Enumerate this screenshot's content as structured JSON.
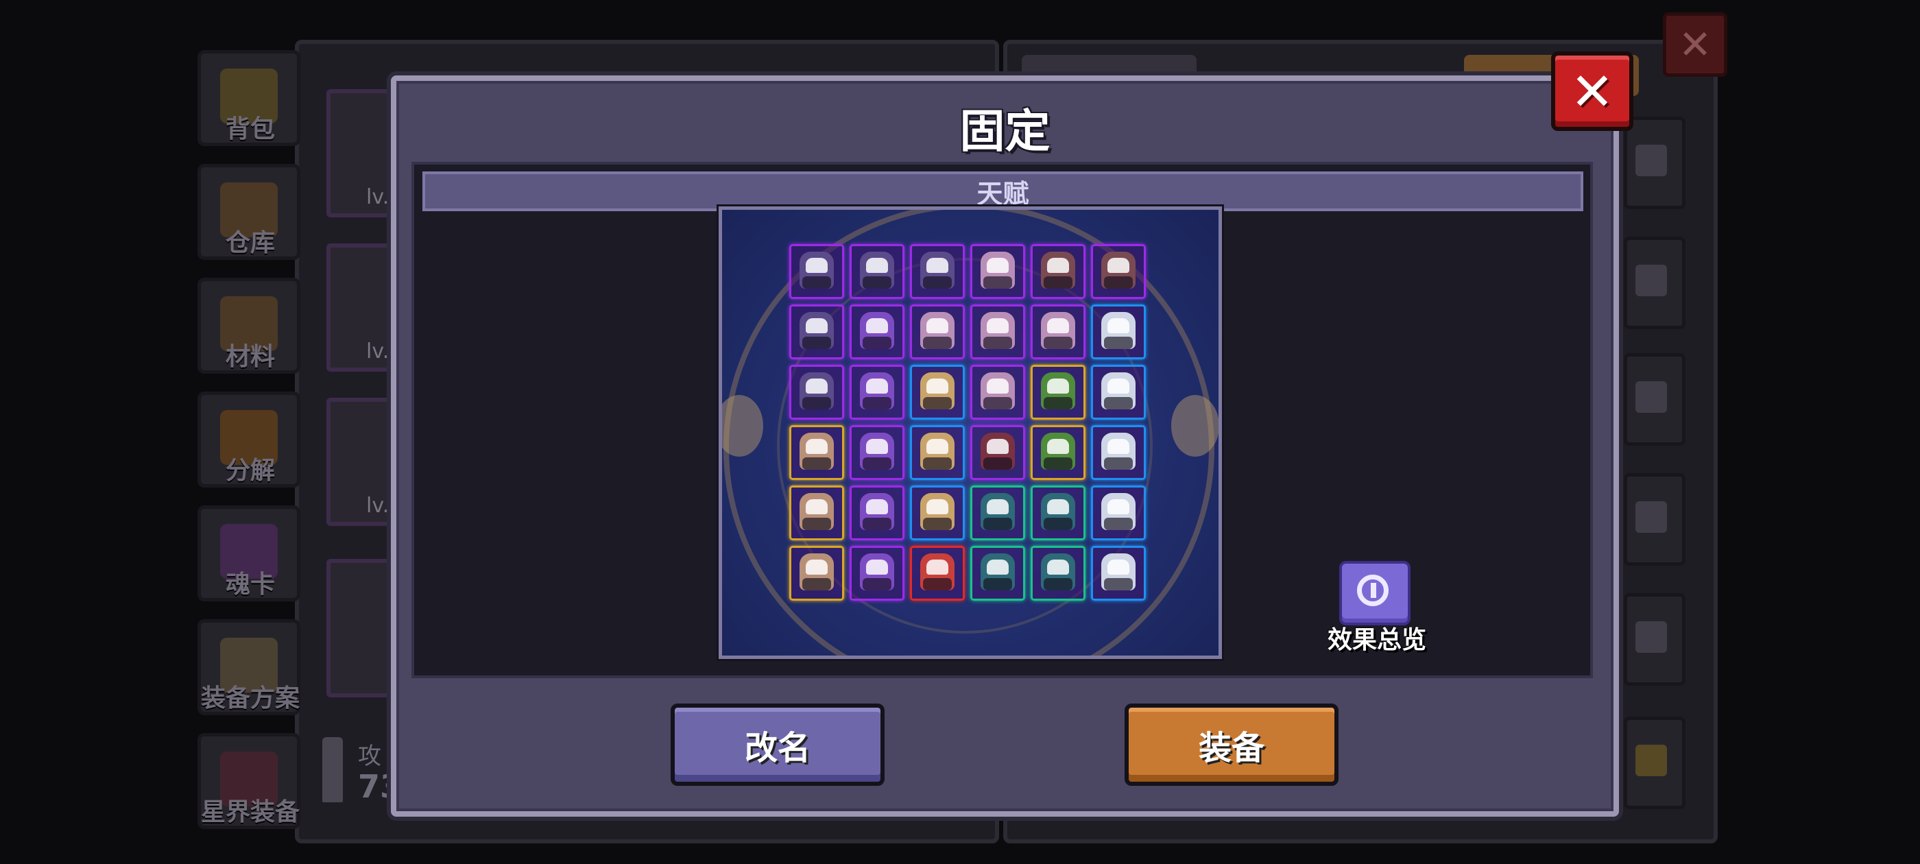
{
  "background": {
    "side_nav": [
      {
        "label": "背包",
        "icon": "backpack-icon",
        "color": "#6b5a1e"
      },
      {
        "label": "仓库",
        "icon": "storage-chest-icon",
        "color": "#6a4a22"
      },
      {
        "label": "材料",
        "icon": "materials-icon",
        "color": "#6a4a22"
      },
      {
        "label": "分解",
        "icon": "dismantle-icon",
        "color": "#7a4a12"
      },
      {
        "label": "魂卡",
        "icon": "soul-card-icon",
        "color": "#5a2a6e"
      },
      {
        "label": "装备方案",
        "icon": "equipment-plan-icon",
        "color": "#6a5a3a"
      },
      {
        "label": "星界装备",
        "icon": "astral-gear-icon",
        "color": "#5a2230"
      }
    ],
    "cards": [
      {
        "lv": "lv."
      },
      {
        "lv": "lv."
      },
      {
        "lv": "lv."
      }
    ],
    "stat": {
      "label": "攻",
      "value": "73"
    }
  },
  "modal": {
    "title": "固定",
    "close_label": "✕",
    "section_header": "天赋",
    "effect_overview_label": "效果总览",
    "rename_button": "改名",
    "equip_button": "装备"
  },
  "talent_grid": {
    "rows": 6,
    "cols": 6,
    "cells": [
      {
        "hero": "purple-hat-mage",
        "frame": "#9b2be6",
        "tint": "#5b4b8a"
      },
      {
        "hero": "purple-hat-mage",
        "frame": "#9b2be6",
        "tint": "#5b4b8a"
      },
      {
        "hero": "purple-hat-mage",
        "frame": "#9b2be6",
        "tint": "#5b4b8a"
      },
      {
        "hero": "pink-hair-hero",
        "frame": "#9b2be6",
        "tint": "#b98fb8"
      },
      {
        "hero": "horned-berserker",
        "frame": "#9b2be6",
        "tint": "#7a4a52"
      },
      {
        "hero": "horned-berserker",
        "frame": "#9b2be6",
        "tint": "#7a4a52"
      },
      {
        "hero": "purple-hat-mage",
        "frame": "#9b2be6",
        "tint": "#5b4b8a"
      },
      {
        "hero": "violet-swordsman",
        "frame": "#9b2be6",
        "tint": "#7d4cc2"
      },
      {
        "hero": "pink-hair-hero",
        "frame": "#9b2be6",
        "tint": "#b98fb8"
      },
      {
        "hero": "pink-hair-hero",
        "frame": "#9b2be6",
        "tint": "#b98fb8"
      },
      {
        "hero": "pink-hair-hero",
        "frame": "#9b2be6",
        "tint": "#b98fb8"
      },
      {
        "hero": "white-hair-knight",
        "frame": "#1f8ff0",
        "tint": "#cfd6e6"
      },
      {
        "hero": "purple-hat-mage",
        "frame": "#9b2be6",
        "tint": "#5b4b8a"
      },
      {
        "hero": "violet-swordsman",
        "frame": "#9b2be6",
        "tint": "#7d4cc2"
      },
      {
        "hero": "trident-warrior",
        "frame": "#1f8ff0",
        "tint": "#c9a46a"
      },
      {
        "hero": "pink-hair-hero",
        "frame": "#9b2be6",
        "tint": "#b98fb8"
      },
      {
        "hero": "green-goblin",
        "frame": "#d9a628",
        "tint": "#4f8c3c"
      },
      {
        "hero": "white-hair-knight",
        "frame": "#1f8ff0",
        "tint": "#cfd6e6"
      },
      {
        "hero": "brown-hair-monk",
        "frame": "#d9a628",
        "tint": "#b89078"
      },
      {
        "hero": "violet-swordsman",
        "frame": "#9b2be6",
        "tint": "#7d4cc2"
      },
      {
        "hero": "trident-warrior",
        "frame": "#1f8ff0",
        "tint": "#c9a46a"
      },
      {
        "hero": "dark-red-brute",
        "frame": "#9b2be6",
        "tint": "#7a3242"
      },
      {
        "hero": "green-goblin",
        "frame": "#d9a628",
        "tint": "#4f8c3c"
      },
      {
        "hero": "white-hair-knight",
        "frame": "#1f8ff0",
        "tint": "#cfd6e6"
      },
      {
        "hero": "brown-hair-monk",
        "frame": "#d9a628",
        "tint": "#b89078"
      },
      {
        "hero": "violet-swordsman",
        "frame": "#9b2be6",
        "tint": "#7d4cc2"
      },
      {
        "hero": "trident-warrior",
        "frame": "#1f8ff0",
        "tint": "#c9a46a"
      },
      {
        "hero": "teal-hood-ranger",
        "frame": "#19c28c",
        "tint": "#2e6a78"
      },
      {
        "hero": "teal-hood-ranger",
        "frame": "#19c28c",
        "tint": "#2e6a78"
      },
      {
        "hero": "white-hair-knight",
        "frame": "#1f8ff0",
        "tint": "#cfd6e6"
      },
      {
        "hero": "brown-hair-monk",
        "frame": "#d9a628",
        "tint": "#b89078"
      },
      {
        "hero": "violet-swordsman",
        "frame": "#9b2be6",
        "tint": "#7d4cc2"
      },
      {
        "hero": "red-hood-rogue",
        "frame": "#e02a2a",
        "tint": "#c8403c"
      },
      {
        "hero": "teal-hood-ranger",
        "frame": "#19c28c",
        "tint": "#2e6a78"
      },
      {
        "hero": "teal-hood-ranger",
        "frame": "#19c28c",
        "tint": "#2e6a78"
      },
      {
        "hero": "white-hair-knight",
        "frame": "#1f8ff0",
        "tint": "#cfd6e6"
      }
    ]
  },
  "colors": {
    "modal_bg": "#4b4662",
    "rename_button": "#6e68aa",
    "equip_button": "#c97a32",
    "close_button": "#c81f22",
    "effect_icon": "#7b6ad6"
  }
}
